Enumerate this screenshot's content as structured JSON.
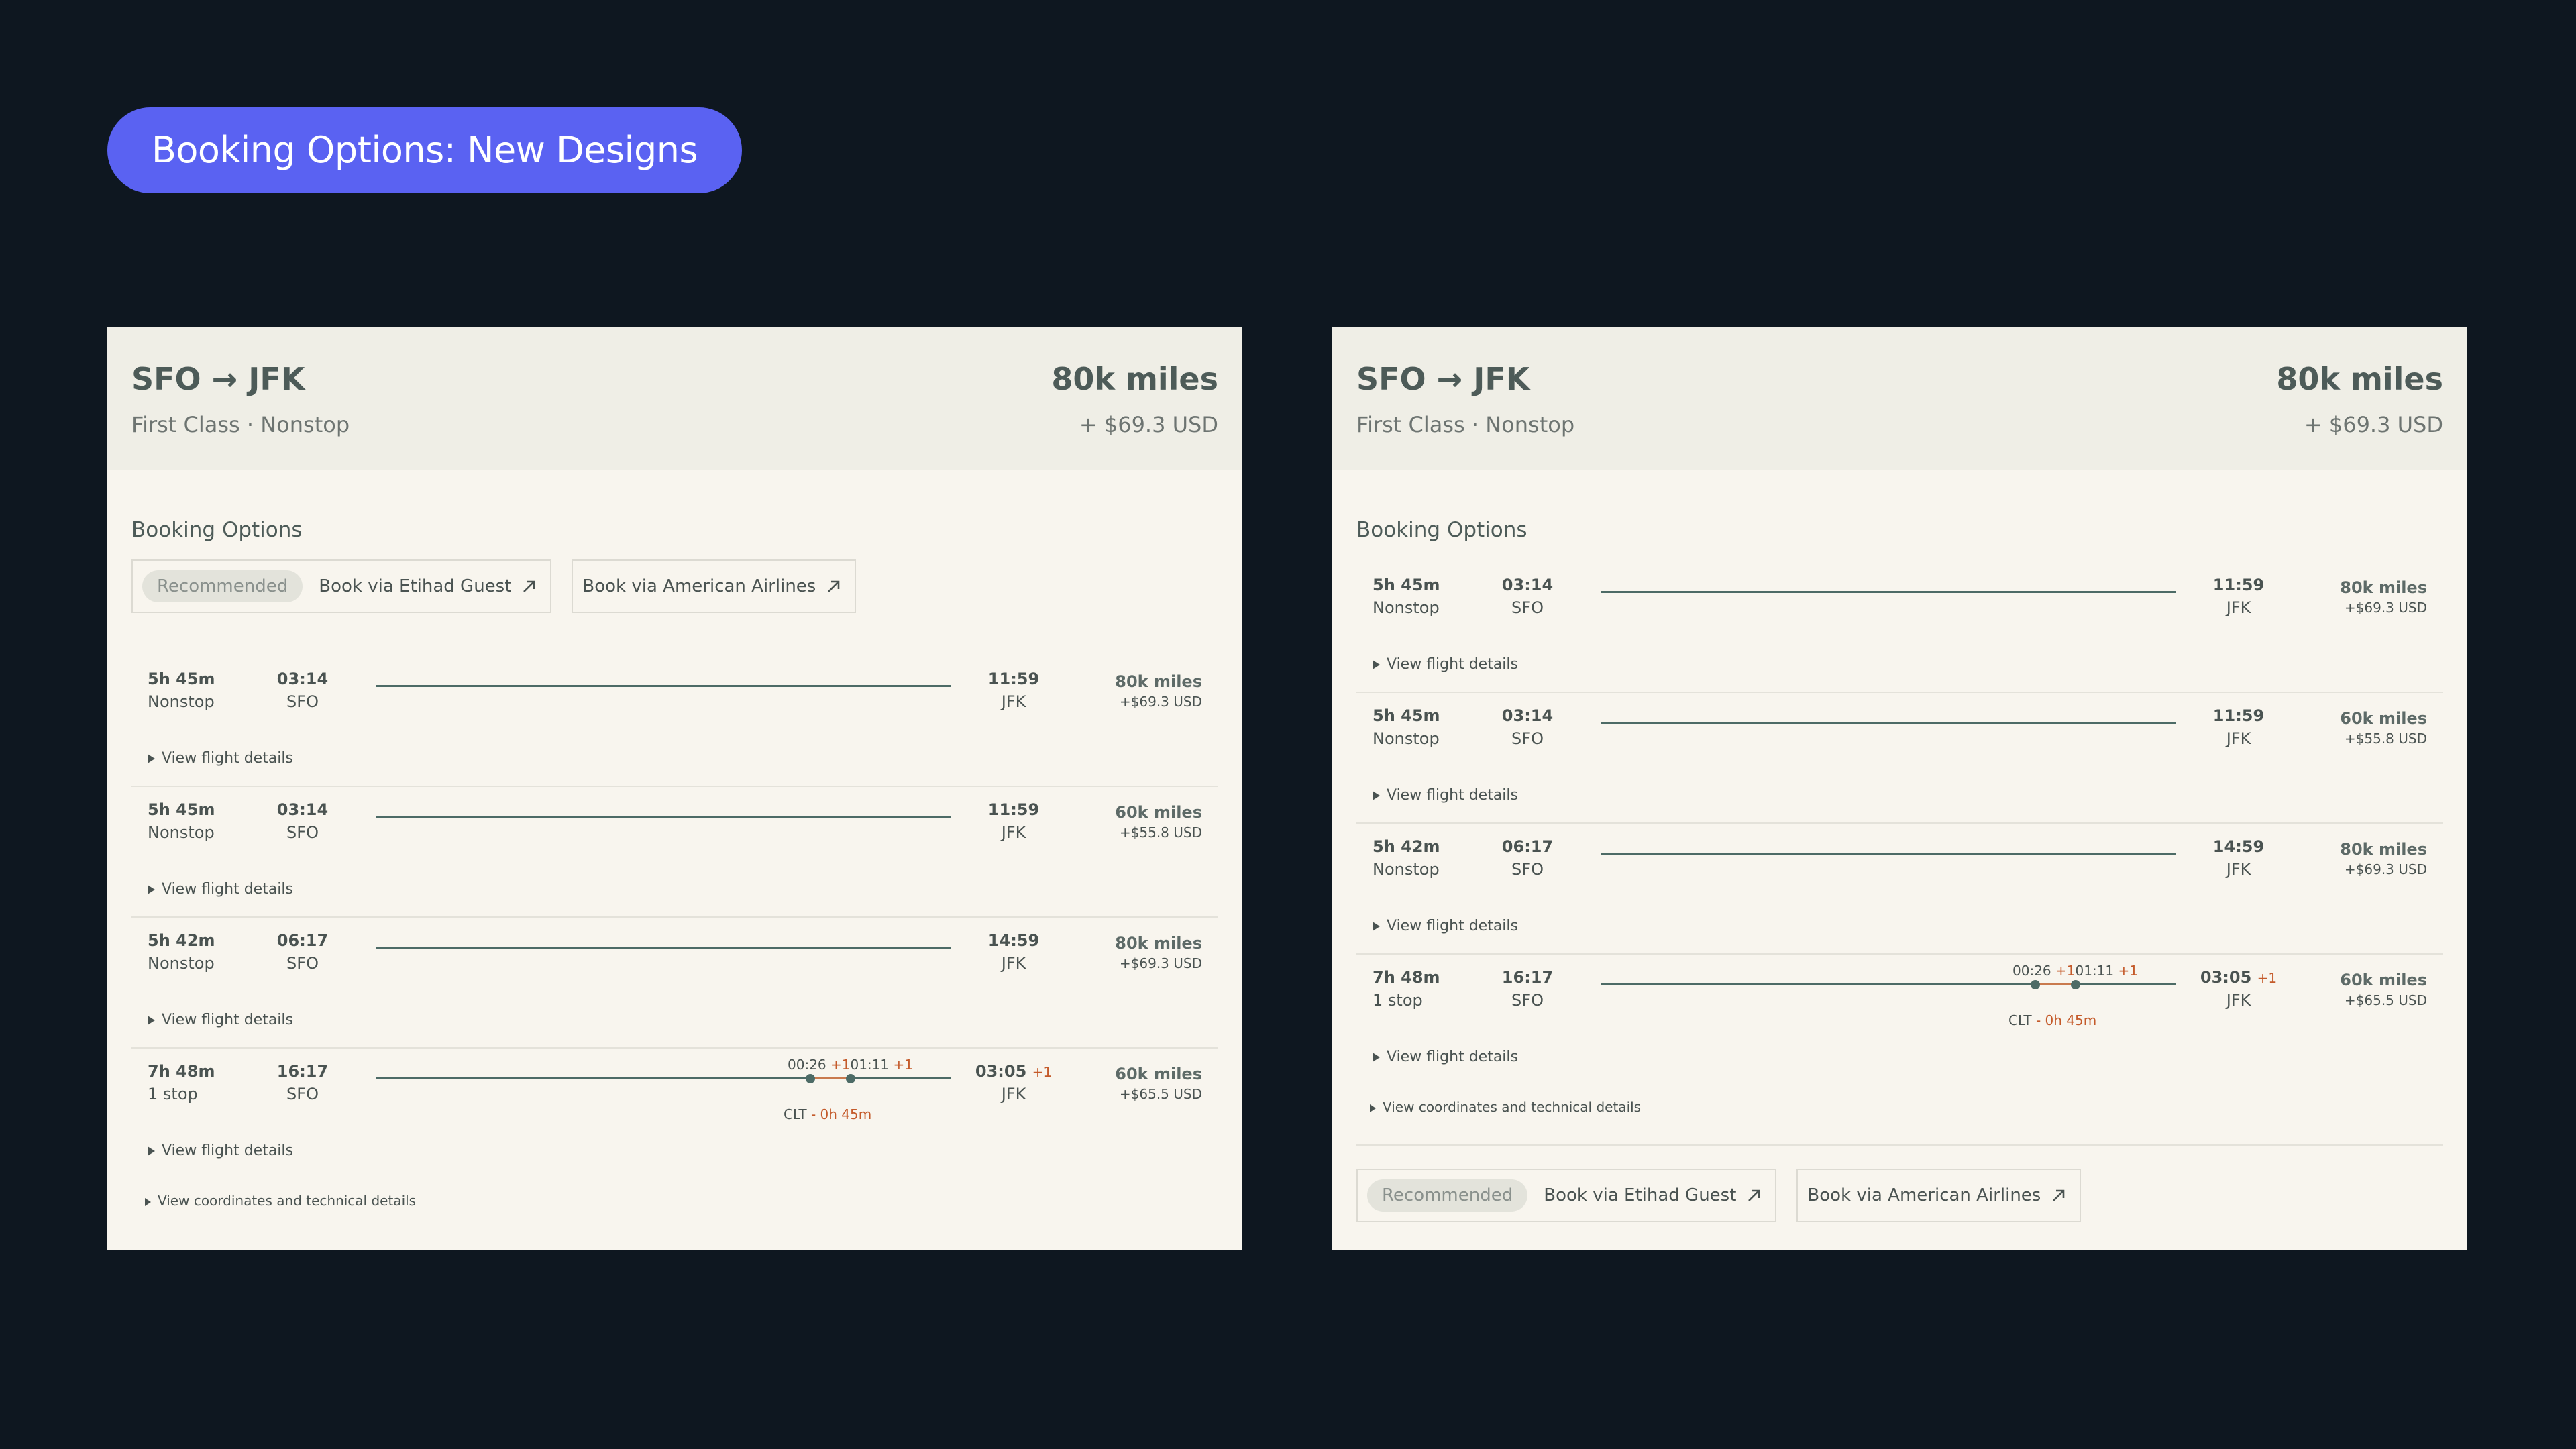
{
  "page_title": "Booking Options: New Designs",
  "cards": [
    {
      "route": "SFO → JFK",
      "subtitle": "First Class · Nonstop",
      "miles": "80k miles",
      "usd": "+ $69.3 USD",
      "section_title": "Booking Options",
      "badge": "Recommended",
      "options": [
        "Book via Etihad Guest",
        "Book via American Airlines"
      ]
    },
    {
      "route": "SFO → JFK",
      "subtitle": "First Class · Nonstop",
      "miles": "80k miles",
      "usd": "+ $69.3 USD",
      "section_title": "Booking Options",
      "badge": "Recommended",
      "options": [
        "Book via Etihad Guest",
        "Book via American Airlines"
      ]
    }
  ],
  "flights": [
    {
      "duration": "5h 45m",
      "stops": "Nonstop",
      "dep_time": "03:14",
      "dep_code": "SFO",
      "arr_time": "11:59",
      "arr_code": "JFK",
      "miles": "80k miles",
      "usd": "+$69.3 USD"
    },
    {
      "duration": "5h 45m",
      "stops": "Nonstop",
      "dep_time": "03:14",
      "dep_code": "SFO",
      "arr_time": "11:59",
      "arr_code": "JFK",
      "miles": "60k miles",
      "usd": "+$55.8 USD"
    },
    {
      "duration": "5h 42m",
      "stops": "Nonstop",
      "dep_time": "06:17",
      "dep_code": "SFO",
      "arr_time": "14:59",
      "arr_code": "JFK",
      "miles": "80k miles",
      "usd": "+$69.3 USD"
    },
    {
      "duration": "7h 48m",
      "stops": "1 stop",
      "dep_time": "16:17",
      "dep_code": "SFO",
      "arr_time": "03:05",
      "arr_plus": "+1",
      "arr_code": "JFK",
      "miles": "60k miles",
      "usd": "+$65.5 USD",
      "layover_times": "00:26",
      "layover_plus1": "+1",
      "layover_times2": "01:11",
      "layover_plus2": "+1",
      "layover_code": "CLT",
      "layover_duration": "- 0h 45m"
    }
  ],
  "view_details": "View flight details",
  "view_coords": "View coordinates and technical details"
}
